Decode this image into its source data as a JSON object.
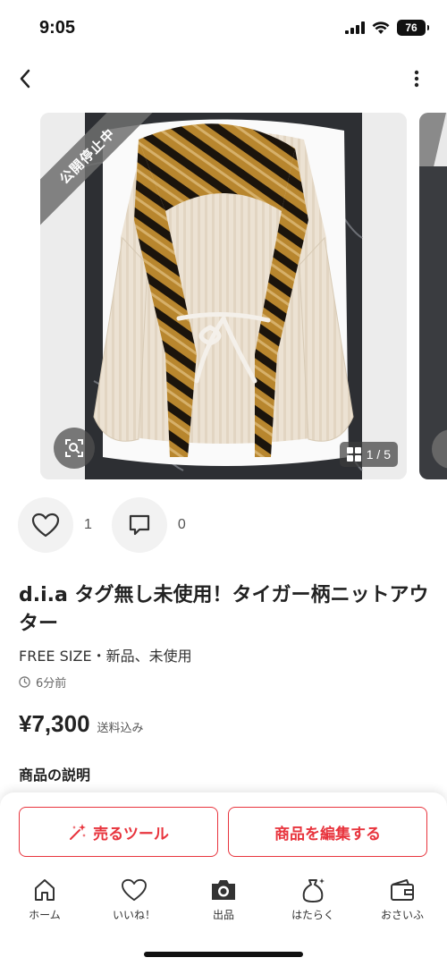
{
  "status_bar": {
    "time": "9:05",
    "battery": "76"
  },
  "gallery": {
    "ribbon_text": "公開停止中",
    "page_indicator": "1 / 5"
  },
  "actions": {
    "like_count": "1",
    "comment_count": "0"
  },
  "item": {
    "title": "d.i.a タグ無し未使用！タイガー柄ニットアウター",
    "condition": "FREE SIZE・新品、未使用",
    "posted": "6分前",
    "price": "¥7,300",
    "shipping": "送料込み",
    "description_heading": "商品の説明"
  },
  "buttons": {
    "sell_tool": "売るツール",
    "edit": "商品を編集する"
  },
  "tabbar": {
    "items": [
      {
        "label": "ホーム",
        "icon": "home-icon"
      },
      {
        "label": "いいね！",
        "icon": "heart-icon"
      },
      {
        "label": "出品",
        "icon": "camera-icon"
      },
      {
        "label": "はたらく",
        "icon": "money-bag-icon"
      },
      {
        "label": "おさいふ",
        "icon": "wallet-icon"
      }
    ]
  },
  "colors": {
    "accent": "#e8343d",
    "ribbon": "#6e6e6e"
  }
}
